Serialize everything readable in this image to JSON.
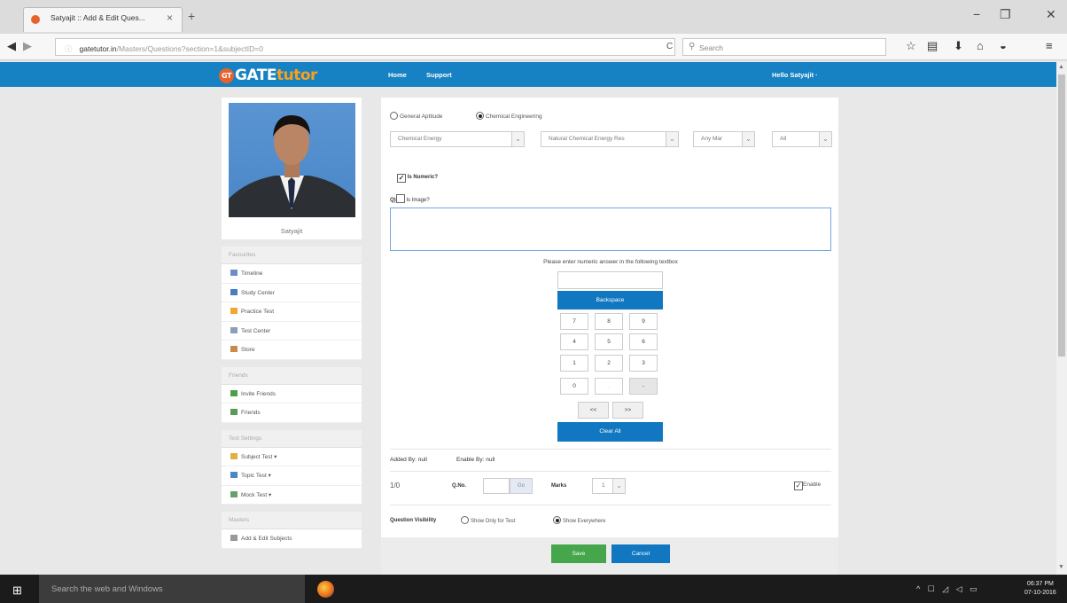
{
  "browser": {
    "tab_title": "Satyajit :: Add & Edit Ques...",
    "tab_close": "×",
    "new_tab": "+",
    "url_host": "gatetutor.in",
    "url_path": "/Masters/Questions?section=1&subjectID=0",
    "search_placeholder": "Search",
    "window_buttons": [
      "−",
      "❐",
      "✕"
    ]
  },
  "site": {
    "logo_gt": "GT",
    "logo_gate": "GATE",
    "logo_tutor": "tutor",
    "nav_home": "Home",
    "nav_support": "Support",
    "greeting": "Hello Satyajit ·"
  },
  "sidebar": {
    "profile_name": "Satyajit",
    "sections": [
      {
        "title": "Favourites",
        "items": [
          "Timeline",
          "Study Center",
          "Practice Test",
          "Test Center",
          "Store"
        ]
      },
      {
        "title": "Friends",
        "items": [
          "Invite Friends",
          "Friends"
        ]
      },
      {
        "title": "Test Settings",
        "items": [
          "Subject Test ▾",
          "Topic Test ▾",
          "Mock Test ▾"
        ]
      },
      {
        "title": "Masters",
        "items": [
          "Add & Edit Subjects"
        ]
      }
    ],
    "icon_colors": [
      "#6b8fc4",
      "#4a7cc0",
      "#f2a533",
      "#8aa0b8",
      "#c98a4a",
      "#4aa14a",
      "#5a9b5a",
      "#e0b040",
      "#4a88c8",
      "#6aa06a",
      "#999999"
    ]
  },
  "form": {
    "radio_general": "General Aptitude",
    "radio_chemical": "Chemical Engineering",
    "select_subject": "Chemical Energy",
    "select_topic": "Natural Chemical Energy Res",
    "select_year": "Any Mar",
    "select_all": "All",
    "is_numeric": "Is Numeric?",
    "q_prefix": "Q)",
    "is_image": "Is Image?",
    "numeric_instruction": "Please enter numeric answer in the following textbox",
    "backspace": "Backspace",
    "keys": [
      "7",
      "8",
      "9",
      "4",
      "5",
      "6",
      "1",
      "2",
      "3",
      "0",
      ".",
      "-"
    ],
    "prev": "<<",
    "next": ">>",
    "clear_all": "Clear All",
    "added_by": "Added By: null",
    "enable_by": "Enable By: null",
    "count": "1/0",
    "q_no_label": "Q.No.",
    "go": "Go",
    "marks_label": "Marks",
    "marks_value": "1",
    "enable": "Enable",
    "visibility_label": "Question Visibility",
    "show_only_test": "Show Only for Test",
    "show_everywhere": "Show Everywhere",
    "save": "Save",
    "cancel": "Cancel"
  },
  "taskbar": {
    "search_text": "Search the web and Windows",
    "time": "06:37 PM",
    "date": "07-10-2016"
  }
}
